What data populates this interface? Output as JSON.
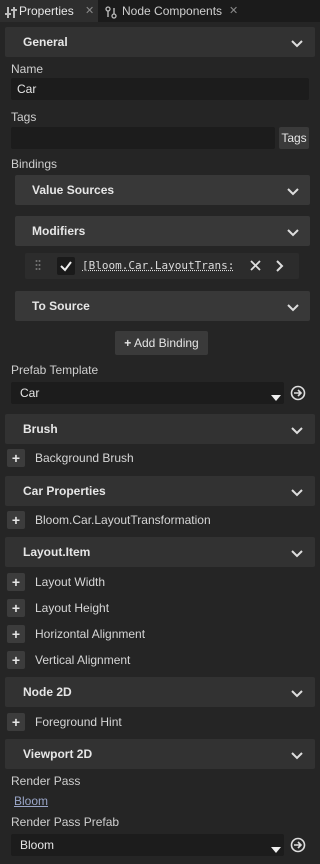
{
  "tabs": [
    {
      "label": "Properties",
      "icon": "properties-icon"
    },
    {
      "label": "Node Components",
      "icon": "node-components-icon"
    }
  ],
  "sections": {
    "general": "General",
    "brush": "Brush",
    "car_properties": "Car Properties",
    "layout_item": "Layout.Item",
    "node_2d": "Node 2D",
    "viewport_2d": "Viewport 2D"
  },
  "general": {
    "name_label": "Name",
    "name_value": "Car",
    "tags_label": "Tags",
    "tags_value": "",
    "tags_button": "Tags",
    "bindings_label": "Bindings",
    "value_sources": "Value Sources",
    "modifiers": "Modifiers",
    "modifier_item": "[Bloom.Car.LayoutTrans:",
    "modifier_checked": true,
    "to_source": "To Source",
    "add_binding": "Add Binding",
    "prefab_template_label": "Prefab Template",
    "prefab_template_value": "Car"
  },
  "brush": {
    "items": [
      "Background Brush"
    ]
  },
  "car_properties": {
    "items": [
      "Bloom.Car.LayoutTransformation"
    ]
  },
  "layout_item": {
    "items": [
      "Layout Width",
      "Layout Height",
      "Horizontal Alignment",
      "Vertical Alignment"
    ]
  },
  "node_2d": {
    "items": [
      "Foreground Hint"
    ]
  },
  "viewport_2d": {
    "render_pass_label": "Render Pass",
    "render_pass_value": "Bloom",
    "render_pass_prefab_label": "Render Pass Prefab",
    "render_pass_prefab_value": "Bloom"
  }
}
